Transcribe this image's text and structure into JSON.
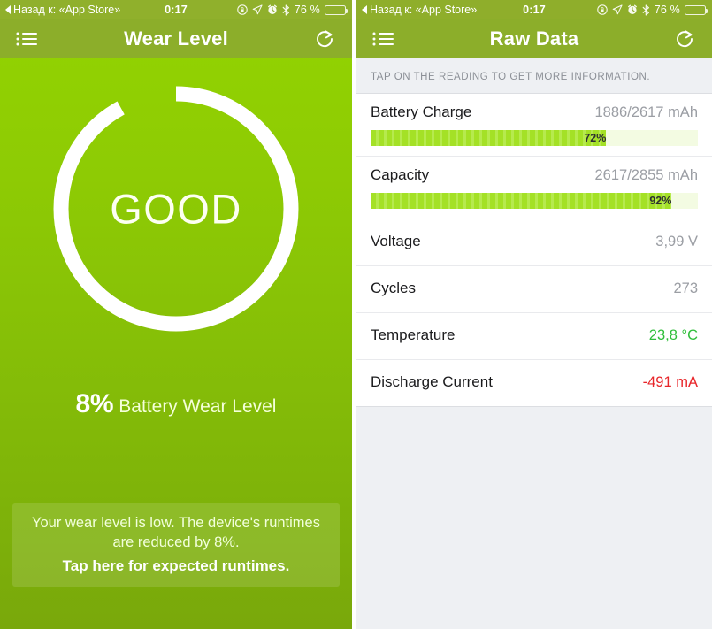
{
  "status_bar": {
    "back_label": "Назад к: «App Store»",
    "time": "0:17",
    "battery_percent": "76 %",
    "icons": [
      "rotation-lock-icon",
      "location-arrow-icon",
      "alarm-clock-icon",
      "bluetooth-icon"
    ]
  },
  "left_screen": {
    "nav": {
      "title": "Wear Level",
      "menu_icon": "list-menu-icon",
      "refresh_icon": "refresh-icon"
    },
    "gauge": {
      "status_label": "GOOD",
      "progress_percent": 92,
      "gap_percent": 8,
      "ring_color": "#ffffff"
    },
    "summary": {
      "percent": "8%",
      "label": "Battery Wear Level"
    },
    "banner": {
      "message": "Your wear level is low. The device's runtimes are reduced by 8%.",
      "cta": "Tap here for expected runtimes."
    },
    "colors": {
      "gradient_top": "#93d400",
      "gradient_bottom": "#79a80b",
      "navbar": "#8cae2a"
    }
  },
  "right_screen": {
    "nav": {
      "title": "Raw Data",
      "menu_icon": "list-menu-icon",
      "refresh_icon": "refresh-icon"
    },
    "hint": "TAP ON THE READING TO GET MORE INFORMATION.",
    "rows": [
      {
        "label": "Battery Charge",
        "value": "1886/2617 mAh",
        "value_color": "#9b9ea4",
        "has_bar": true,
        "bar_percent": 72,
        "bar_label": "72%"
      },
      {
        "label": "Capacity",
        "value": "2617/2855 mAh",
        "value_color": "#9b9ea4",
        "has_bar": true,
        "bar_percent": 92,
        "bar_label": "92%"
      },
      {
        "label": "Voltage",
        "value": "3,99 V",
        "value_color": "#9b9ea4",
        "has_bar": false
      },
      {
        "label": "Cycles",
        "value": "273",
        "value_color": "#9b9ea4",
        "has_bar": false
      },
      {
        "label": "Temperature",
        "value": "23,8 °C",
        "value_color": "#2fbe3a",
        "has_bar": false
      },
      {
        "label": "Discharge Current",
        "value": "-491 mA",
        "value_color": "#e8262a",
        "has_bar": false
      }
    ]
  }
}
